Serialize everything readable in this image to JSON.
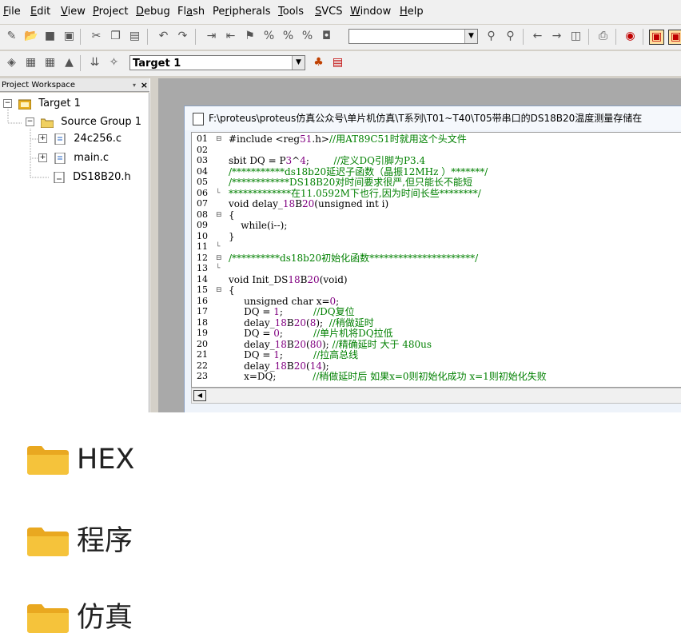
{
  "menu": [
    {
      "pre": "",
      "u": "F",
      "post": "ile"
    },
    {
      "pre": "",
      "u": "E",
      "post": "dit"
    },
    {
      "pre": "",
      "u": "V",
      "post": "iew"
    },
    {
      "pre": "",
      "u": "P",
      "post": "roject"
    },
    {
      "pre": "",
      "u": "D",
      "post": "ebug"
    },
    {
      "pre": "Fl",
      "u": "a",
      "post": "sh"
    },
    {
      "pre": "Pe",
      "u": "r",
      "post": "ipherals"
    },
    {
      "pre": "",
      "u": "T",
      "post": "ools"
    },
    {
      "pre": "",
      "u": "S",
      "post": "VCS"
    },
    {
      "pre": "",
      "u": "W",
      "post": "indow"
    },
    {
      "pre": "",
      "u": "H",
      "post": "elp"
    }
  ],
  "toolbar": {
    "find_combo_value": "",
    "target_combo_value": "Target 1"
  },
  "workspace": {
    "title": "Project Workspace",
    "pin": "▾",
    "close": "×",
    "tree": {
      "target": "Target 1",
      "group": "Source Group 1",
      "files": [
        "24c256.c",
        "main.c",
        "DS18B20.h"
      ]
    }
  },
  "editor": {
    "path": "F:\\proteus\\proteus仿真公众号\\单片机仿真\\T系列\\T01~T40\\T05带串口的DS18B20温度测量存储在",
    "lines": [
      {
        "n": "01",
        "fold": "⊟",
        "code": "#include <reg51.h>",
        "comment": "//用AT89C51时就用这个头文件"
      },
      {
        "n": "02",
        "fold": "",
        "code": "",
        "comment": ""
      },
      {
        "n": "03",
        "fold": "",
        "code": "sbit DQ = P3^4;        ",
        "comment": "//定义DQ引脚为P3.4"
      },
      {
        "n": "04",
        "fold": "",
        "code": "",
        "comment": "/***********ds18b20延迟子函数（晶振12MHz ）*******/"
      },
      {
        "n": "05",
        "fold": "",
        "code": "",
        "comment": "/************DS18B20对时间要求很严,但只能长不能短"
      },
      {
        "n": "06",
        "fold": "└",
        "code": "",
        "comment": "*************在11.0592M下也行,因为时间长些********/"
      },
      {
        "n": "07",
        "fold": "",
        "code": "void delay_18B20(unsigned int i)",
        "comment": ""
      },
      {
        "n": "08",
        "fold": "⊟",
        "code": "{",
        "comment": ""
      },
      {
        "n": "09",
        "fold": "",
        "code": "    while(i--);",
        "comment": ""
      },
      {
        "n": "10",
        "fold": "",
        "code": "}",
        "comment": ""
      },
      {
        "n": "11",
        "fold": "└",
        "code": "",
        "comment": ""
      },
      {
        "n": "12",
        "fold": "⊟",
        "code": "",
        "comment": "/**********ds18b20初始化函数**********************/"
      },
      {
        "n": "13",
        "fold": "└",
        "code": "",
        "comment": ""
      },
      {
        "n": "14",
        "fold": "",
        "code": "void Init_DS18B20(void)",
        "comment": ""
      },
      {
        "n": "15",
        "fold": "⊟",
        "code": "{",
        "comment": ""
      },
      {
        "n": "16",
        "fold": "",
        "code": "     unsigned char x=0;",
        "comment": ""
      },
      {
        "n": "17",
        "fold": "",
        "code": "     DQ = 1;          ",
        "comment": "//DQ复位"
      },
      {
        "n": "18",
        "fold": "",
        "code": "     delay_18B20(8);  ",
        "comment": "//稍做延时"
      },
      {
        "n": "19",
        "fold": "",
        "code": "     DQ = 0;          ",
        "comment": "//单片机将DQ拉低"
      },
      {
        "n": "20",
        "fold": "",
        "code": "     delay_18B20(80); ",
        "comment": "//精确延时 大于 480us"
      },
      {
        "n": "21",
        "fold": "",
        "code": "     DQ = 1;          ",
        "comment": "//拉高总线"
      },
      {
        "n": "22",
        "fold": "",
        "code": "     delay_18B20(14);",
        "comment": ""
      },
      {
        "n": "23",
        "fold": "",
        "code": "     x=DQ;            ",
        "comment": "//稍做延时后 如果x=0则初始化成功 x=1则初始化失败"
      }
    ]
  },
  "folders": [
    "HEX",
    "程序",
    "仿真"
  ],
  "colors": {
    "folder": "#f5c33b",
    "comment": "#008000",
    "ide_bg": "#d4d0c8"
  }
}
